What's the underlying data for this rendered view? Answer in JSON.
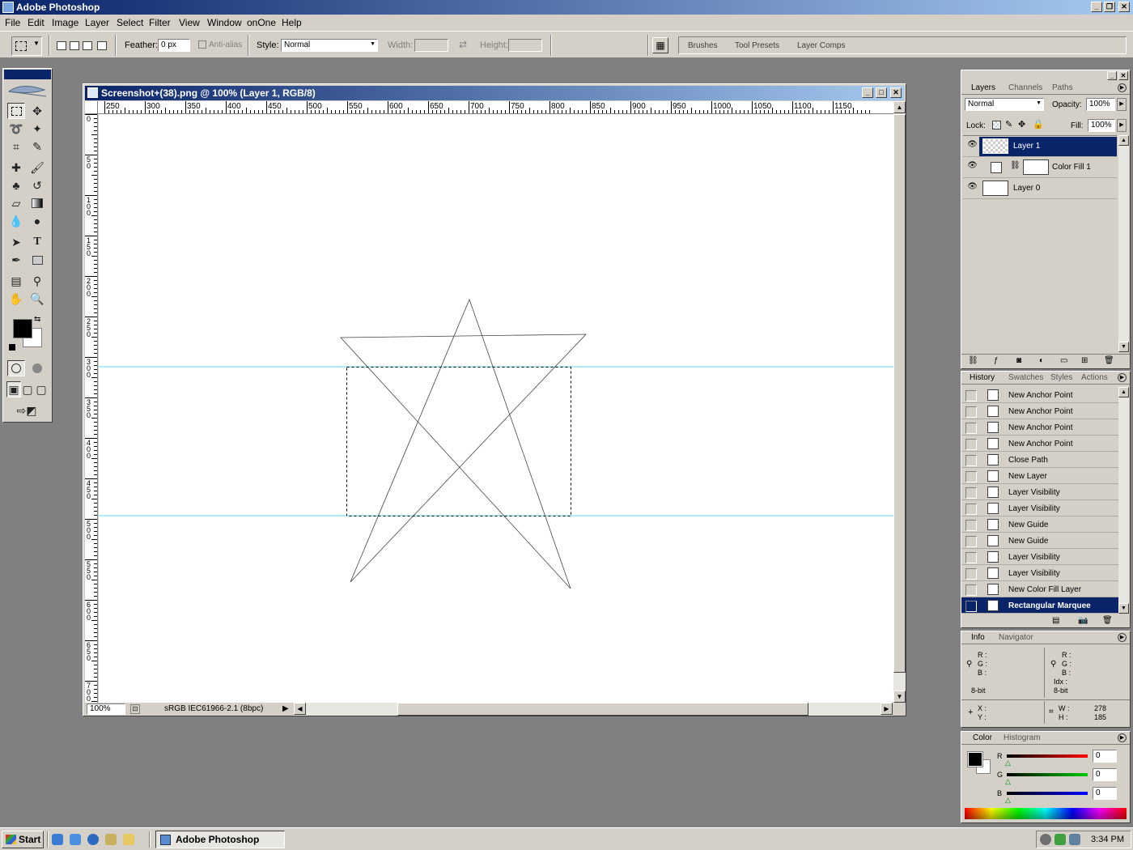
{
  "app": {
    "title": "Adobe Photoshop"
  },
  "menu": [
    "File",
    "Edit",
    "Image",
    "Layer",
    "Select",
    "Filter",
    "View",
    "Window",
    "onOne",
    "Help"
  ],
  "options": {
    "feather_label": "Feather:",
    "feather_value": "0 px",
    "antialias_label": "Anti-alias",
    "style_label": "Style:",
    "style_value": "Normal",
    "width_label": "Width:",
    "height_label": "Height:",
    "well_tabs": [
      "Brushes",
      "Tool Presets",
      "Layer Comps"
    ]
  },
  "document": {
    "title": "Screenshot+(38).png @ 100% (Layer 1, RGB/8)",
    "zoom": "100%",
    "profile": "sRGB IEC61966-2.1 (8bpc)",
    "ruler_h": [
      "250",
      "300",
      "350",
      "400",
      "450",
      "500",
      "550",
      "600",
      "650",
      "700",
      "750",
      "800",
      "850",
      "900",
      "950",
      "1000",
      "1050",
      "1100",
      "1150"
    ],
    "ruler_v": [
      "0",
      "50",
      "100",
      "150",
      "200",
      "250",
      "300",
      "350",
      "400",
      "450",
      "500",
      "550",
      "600",
      "650",
      "700"
    ]
  },
  "layers_palette": {
    "tabs": [
      "Layers",
      "Channels",
      "Paths"
    ],
    "blend_mode": "Normal",
    "opacity_label": "Opacity:",
    "opacity": "100%",
    "lock_label": "Lock:",
    "fill_label": "Fill:",
    "fill": "100%",
    "layers": [
      {
        "name": "Layer 1",
        "selected": true
      },
      {
        "name": "Color Fill 1",
        "selected": false
      },
      {
        "name": "Layer 0",
        "selected": false
      }
    ]
  },
  "history_palette": {
    "tabs": [
      "History",
      "Swatches",
      "Styles",
      "Actions"
    ],
    "items": [
      "New Anchor Point",
      "New Anchor Point",
      "New Anchor Point",
      "New Anchor Point",
      "Close Path",
      "New Layer",
      "Layer Visibility",
      "Layer Visibility",
      "New Guide",
      "New Guide",
      "Layer Visibility",
      "Layer Visibility",
      "New Color Fill Layer",
      "Rectangular Marquee"
    ],
    "selected_index": 13
  },
  "info_palette": {
    "tabs": [
      "Info",
      "Navigator"
    ],
    "left": {
      "r": "R :",
      "g": "G :",
      "b": "B :",
      "bit": "8-bit"
    },
    "right": {
      "r": "R :",
      "g": "G :",
      "b": "B :",
      "idx": "Idx :",
      "bit": "8-bit"
    },
    "x_label": "X :",
    "y_label": "Y :",
    "w_label": "W :",
    "h_label": "H :",
    "w": "278",
    "h": "185"
  },
  "color_palette": {
    "tabs": [
      "Color",
      "Histogram"
    ],
    "r_label": "R",
    "g_label": "G",
    "b_label": "B",
    "r": "0",
    "g": "0",
    "b": "0"
  },
  "taskbar": {
    "start": "Start",
    "task": "Adobe Photoshop",
    "clock": "3:34 PM"
  },
  "colors": {
    "title_active": "#0a246a",
    "guide": "#00c8d8",
    "face": "#d4d0c8",
    "workspace": "#808080"
  }
}
